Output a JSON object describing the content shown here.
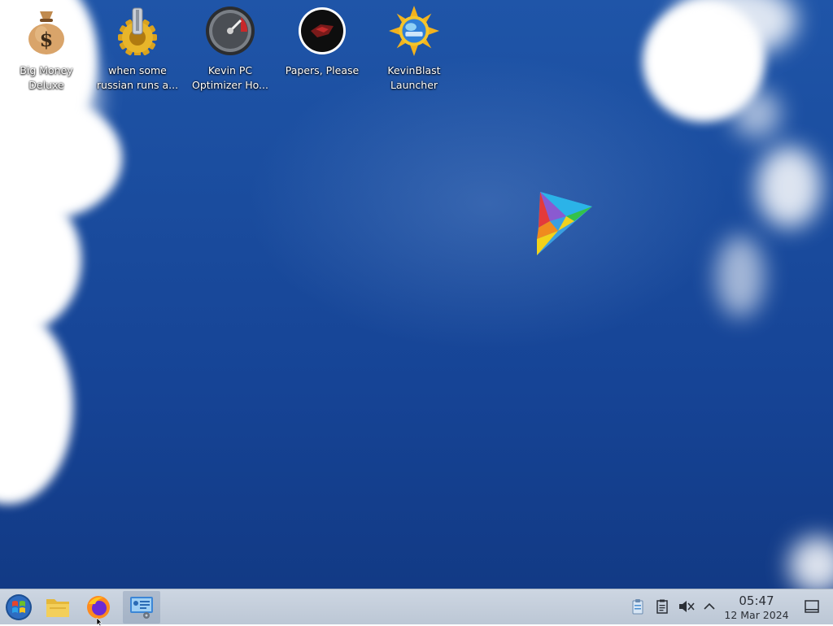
{
  "desktop": {
    "icons": [
      {
        "label": "Big Money Deluxe",
        "icon": "money-bag-icon"
      },
      {
        "label": "when some russian runs a...",
        "icon": "gear-icon"
      },
      {
        "label": "Kevin PC Optimizer Ho...",
        "icon": "speedometer-icon"
      },
      {
        "label": "Papers, Please",
        "icon": "papers-please-icon"
      },
      {
        "label": "KevinBlast Launcher",
        "icon": "sun-globe-icon"
      }
    ]
  },
  "taskbar": {
    "apps": [
      {
        "name": "start-menu",
        "icon": "windows-orb-icon"
      },
      {
        "name": "file-manager",
        "icon": "folder-icon"
      },
      {
        "name": "firefox",
        "icon": "firefox-icon"
      },
      {
        "name": "system-info",
        "icon": "system-settings-icon"
      }
    ],
    "tray": [
      "clipboard-icon",
      "notes-icon",
      "speaker-muted-icon",
      "chevron-up-icon"
    ],
    "clock": {
      "time": "05:47",
      "date": "12 Mar 2024"
    },
    "show_desktop_icon": "show-desktop-icon"
  },
  "colors": {
    "sky": "#1a4c9e",
    "taskbar": "#c4cedb"
  }
}
